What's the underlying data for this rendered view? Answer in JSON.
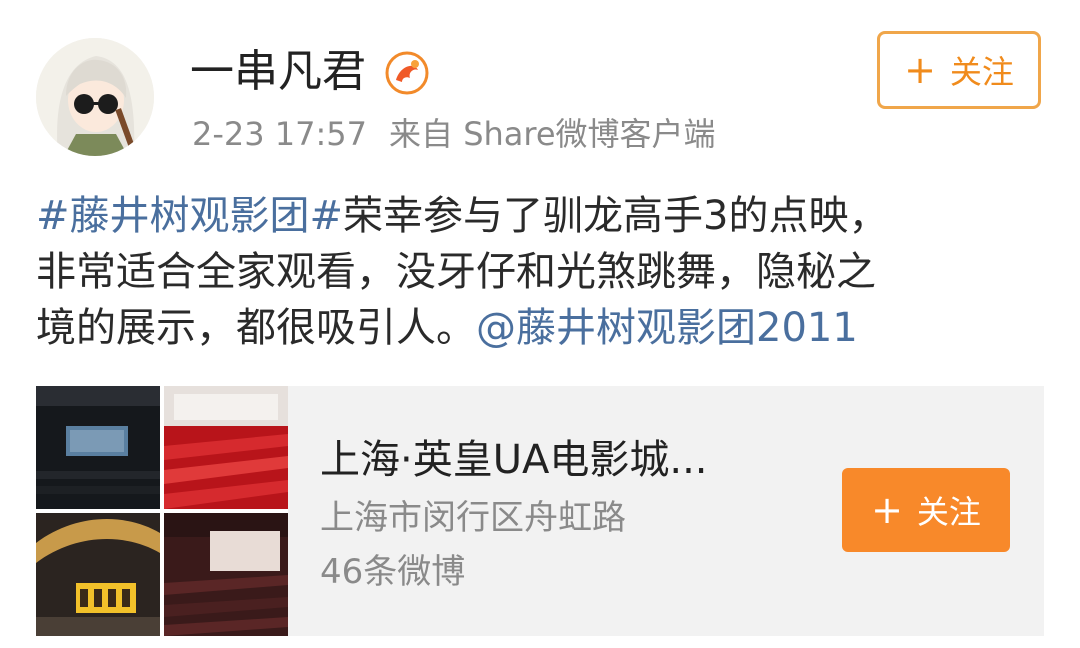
{
  "post": {
    "author": "一串凡君",
    "time": "2-23 17:57",
    "source": "来自 Share微博客户端",
    "follow_label": "关注",
    "follow_plus": "+",
    "text": {
      "tag": "#藤井树观影团#",
      "line1_rest": "荣幸参与了驯龙高手3的点映，",
      "line2": "非常适合全家观看，没牙仔和光煞跳舞，隐秘之",
      "line3_start": "境的展示，都很吸引人。",
      "mention": "@藤井树观影团2011"
    }
  },
  "location_card": {
    "title": "上海·英皇UA电影城...",
    "address": "上海市闵行区舟虹路",
    "count": "46条微博",
    "follow_label": "关注",
    "follow_plus": "+"
  },
  "colors": {
    "link": "#4a6f9e",
    "follow_orange": "#f8892a",
    "follow_outline": "#f0a64a"
  }
}
